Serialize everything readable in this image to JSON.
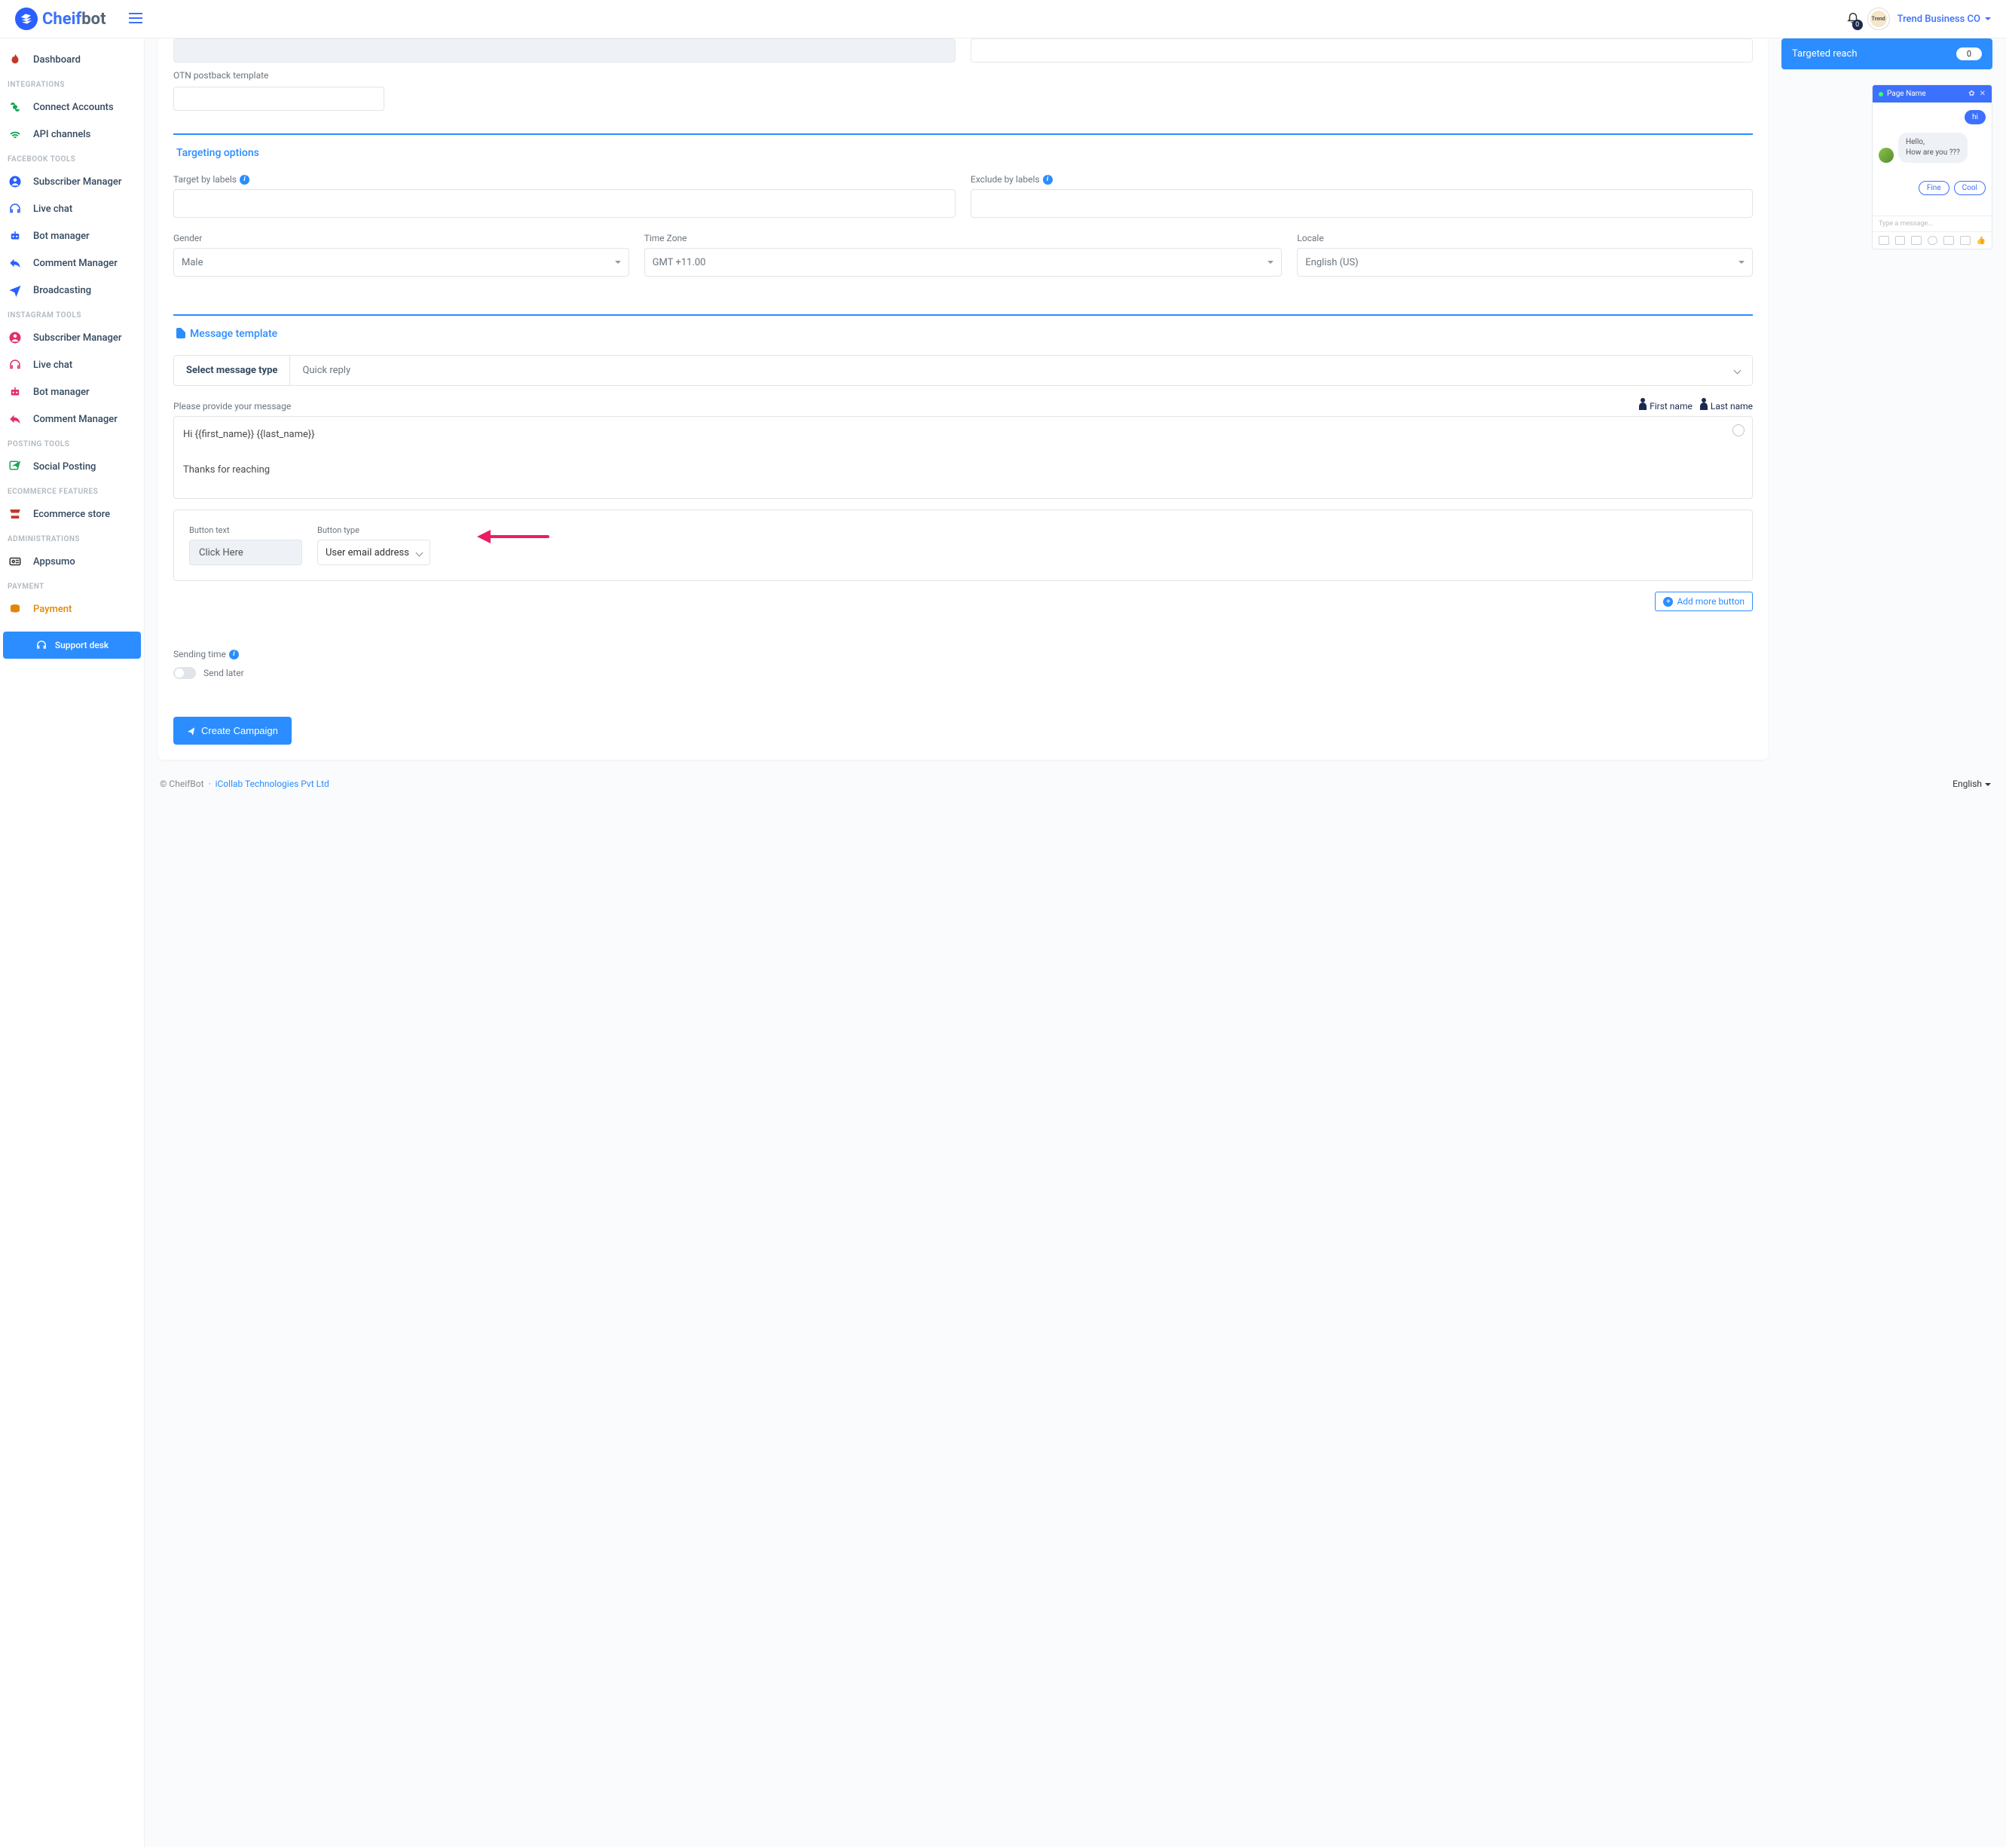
{
  "brand": {
    "name_pre": "Cheif",
    "name_post": "bot"
  },
  "topbar": {
    "notif_count": "0",
    "account": "Trend Business CO"
  },
  "sidebar": {
    "dashboard": "Dashboard",
    "sections": {
      "integrations": "INTEGRATIONS",
      "facebook": "FACEBOOK TOOLS",
      "instagram": "INSTAGRAM TOOLS",
      "posting": "POSTING TOOLS",
      "ecommerce": "ECOMMERCE FEATURES",
      "admin": "ADMINISTRATIONS",
      "payment": "PAYMENT"
    },
    "items": {
      "connect": "Connect Accounts",
      "api": "API channels",
      "fb_sub": "Subscriber Manager",
      "fb_chat": "Live chat",
      "fb_bot": "Bot manager",
      "fb_comment": "Comment Manager",
      "broadcasting": "Broadcasting",
      "ig_sub": "Subscriber Manager",
      "ig_chat": "Live chat",
      "ig_bot": "Bot manager",
      "ig_comment": "Comment Manager",
      "social": "Social Posting",
      "ecom": "Ecommerce store",
      "appsumo": "Appsumo",
      "payment": "Payment"
    },
    "support": "Support desk"
  },
  "form": {
    "otn_label": "OTN postback template",
    "targeting_title": "Targeting options",
    "target_by": "Target by labels",
    "exclude_by": "Exclude by labels",
    "gender_label": "Gender",
    "gender_value": "Male",
    "tz_label": "Time Zone",
    "tz_value": "GMT +11.00",
    "locale_label": "Locale",
    "locale_value": "English (US)",
    "msg_template_title": "Message template",
    "select_type_label": "Select message type",
    "select_type_value": "Quick reply",
    "provide_msg": "Please provide your message",
    "tag_first": "First name",
    "tag_last": "Last name",
    "message_line1": "Hi  {{first_name}} {{last_name}}",
    "message_line2": "Thanks for reaching",
    "button_text_label": "Button text",
    "button_text_value": "Click Here",
    "button_type_label": "Button type",
    "button_type_value": "User email address",
    "add_more": "Add more button",
    "sending_time": "Sending time",
    "send_later": "Send later",
    "create": "Create Campaign"
  },
  "right": {
    "reach_label": "Targeted reach",
    "reach_value": "0",
    "chat": {
      "page_name": "Page Name",
      "hi": "hi",
      "hello": "Hello,",
      "how": "How are you  ???",
      "fine": "Fine",
      "cool": "Cool",
      "placeholder": "Type a message..."
    }
  },
  "footer": {
    "copyright": "© CheifBot",
    "dot": "·",
    "company": "iCollab Technologies Pvt Ltd",
    "lang": "English"
  }
}
